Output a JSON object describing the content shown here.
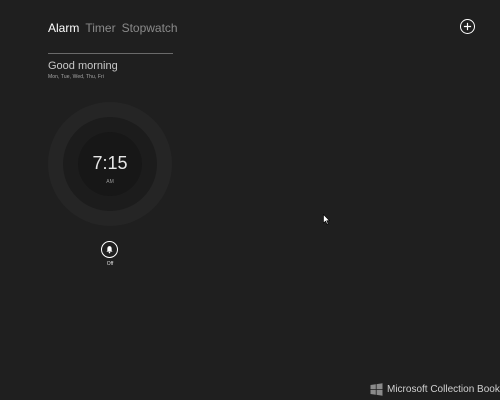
{
  "tabs": [
    {
      "label": "Alarm",
      "active": true
    },
    {
      "label": "Timer",
      "active": false
    },
    {
      "label": "Stopwatch",
      "active": false
    }
  ],
  "alarm": {
    "name": "Good morning",
    "days": "Mon, Tue, Wed, Thu, Fri",
    "time": "7:15",
    "period": "AM",
    "state": "Off"
  },
  "icons": {
    "add": "plus-in-circle",
    "toggle": "bell",
    "cursor": "arrow-pointer",
    "logo": "windows-logo"
  },
  "watermark": "Microsoft Collection Book",
  "colors": {
    "background": "#1f1f1f",
    "text": "#ffffff",
    "tab_inactive": "#8a8a8a"
  }
}
